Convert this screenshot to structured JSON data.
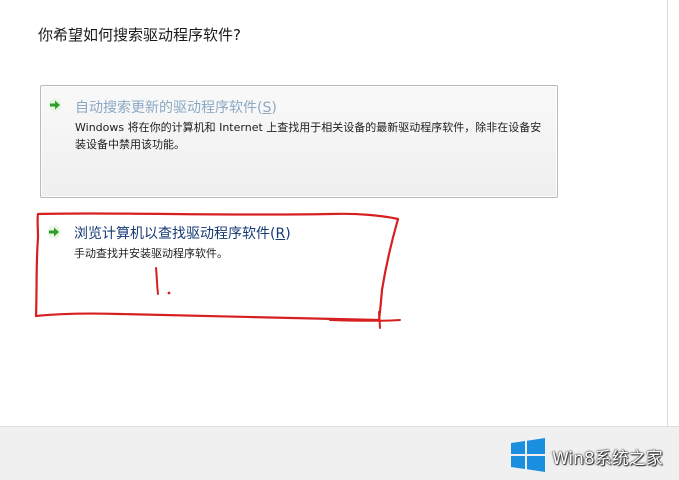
{
  "dialog": {
    "heading": "你希望如何搜索驱动程序软件?"
  },
  "options": {
    "auto": {
      "title_main": "自动搜索更新的驱动程序软件(",
      "hotkey": "S",
      "title_end": ")",
      "description": "Windows 将在你的计算机和 Internet 上查找用于相关设备的最新驱动程序软件，除非在设备安装设备中禁用该功能。"
    },
    "browse": {
      "title_main": "浏览计算机以查找驱动程序软件(",
      "hotkey": "R",
      "title_end": ")",
      "description": "手动查找并安装驱动程序软件。"
    }
  },
  "icons": {
    "option_arrow": "green-arrow-icon",
    "windows_logo": "windows-logo-icon"
  },
  "colors": {
    "arrow_green": "#2e9d2a",
    "annotation_red": "#d62020",
    "logo_blue": "#1a8fe0",
    "browse_title": "#163a72",
    "auto_title": "#8aa9c4"
  },
  "watermark": {
    "text": "Win8系统之家"
  }
}
